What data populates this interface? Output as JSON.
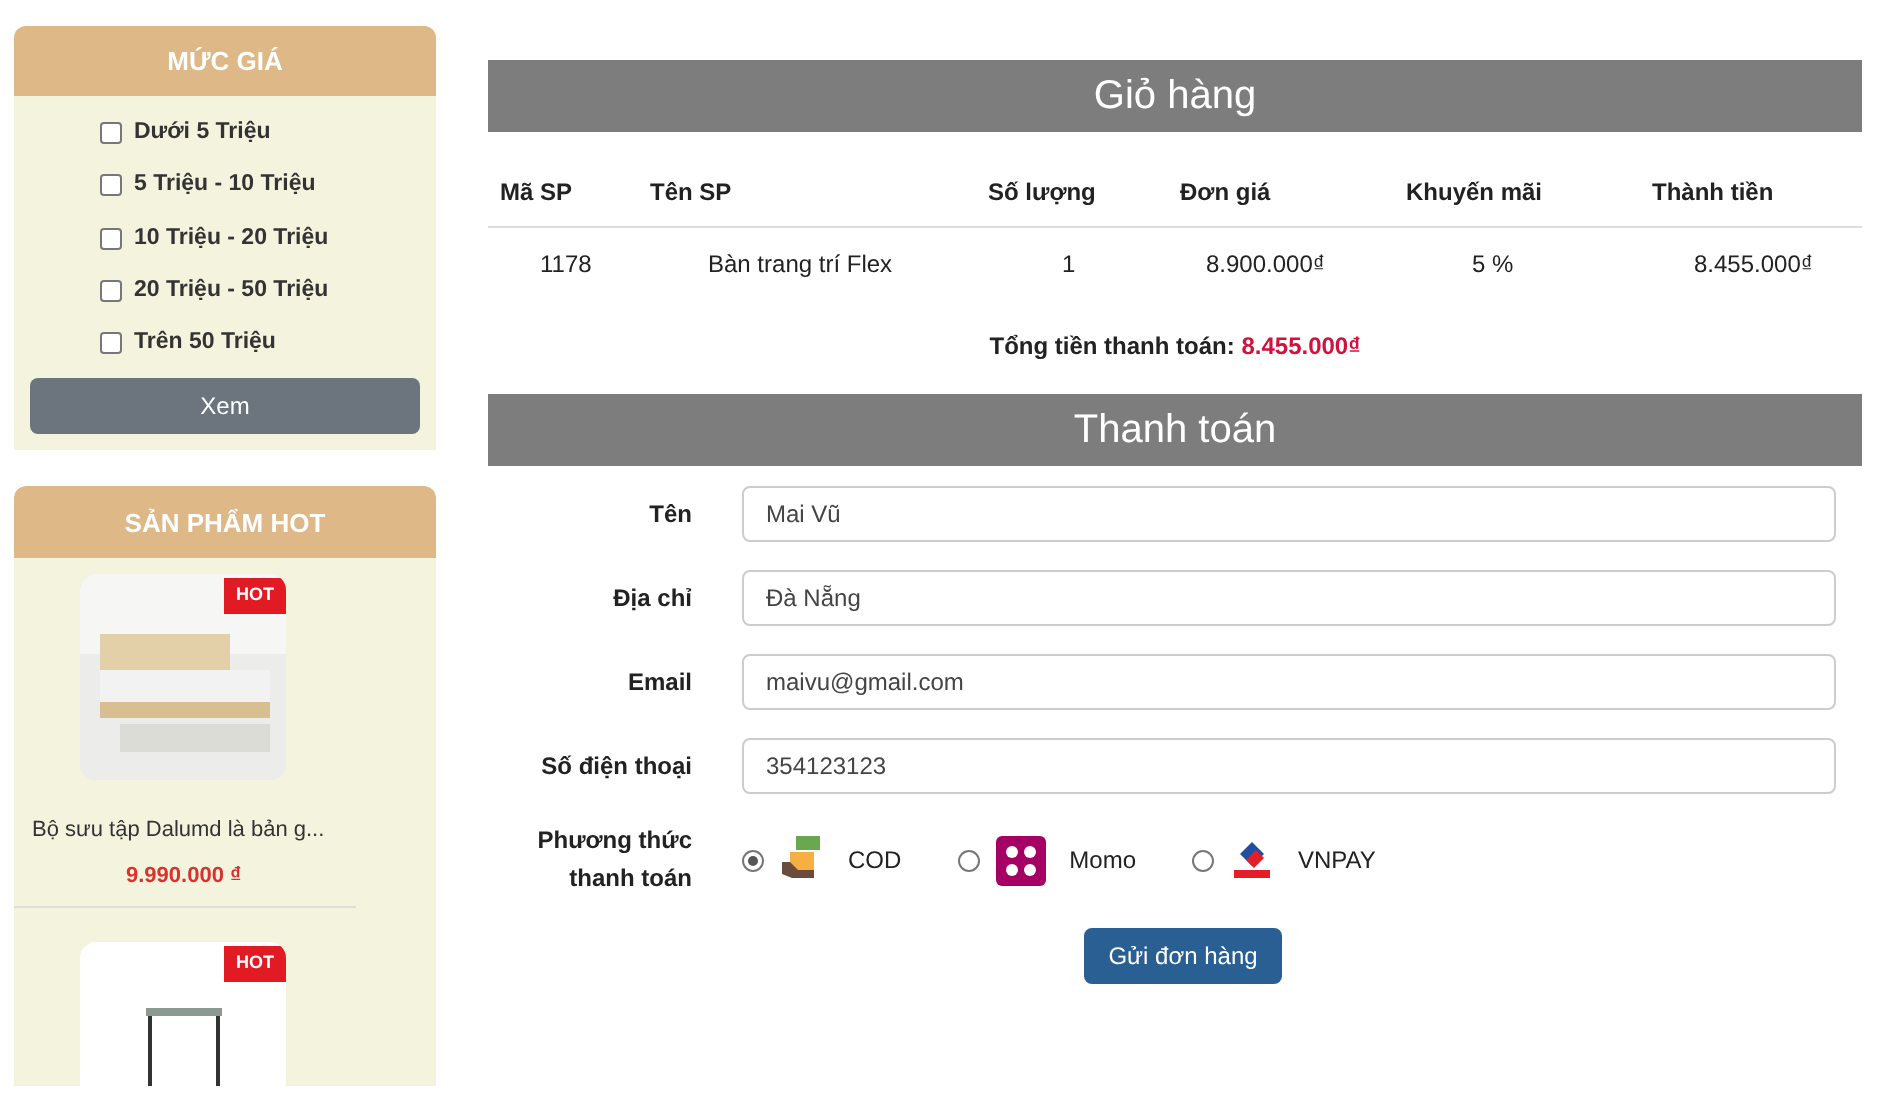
{
  "price_filter": {
    "title": "MỨC GIÁ",
    "options": [
      {
        "label": "Dưới 5 Triệu",
        "checked": false
      },
      {
        "label": "5 Triệu - 10 Triệu",
        "checked": false
      },
      {
        "label": "10 Triệu - 20 Triệu",
        "checked": false
      },
      {
        "label": "20 Triệu - 50 Triệu",
        "checked": false
      },
      {
        "label": "Trên 50 Triệu",
        "checked": false
      }
    ],
    "button": "Xem"
  },
  "hot_products": {
    "title": "SẢN PHẨM HOT",
    "items": [
      {
        "kind": "bed",
        "badge": "HOT",
        "name": "Bộ sưu tập Dalumd là bản g...",
        "price": "9.990.000 ₫"
      },
      {
        "kind": "table",
        "badge": "HOT"
      }
    ]
  },
  "cart": {
    "title": "Giỏ hàng",
    "columns": [
      "Mã SP",
      "Tên SP",
      "Số lượng",
      "Đơn giá",
      "Khuyến mãi",
      "Thành tiền"
    ],
    "rows": [
      [
        "1178",
        "Bàn trang trí Flex",
        "1",
        "8.900.000₫",
        "5 %",
        "8.455.000₫"
      ]
    ],
    "total_label": "Tổng tiền thanh toán:",
    "total_value": "8.455.000₫"
  },
  "checkout": {
    "title": "Thanh toán",
    "fields": [
      {
        "label": "Tên",
        "value": "Mai Vũ"
      },
      {
        "label": "Địa chỉ",
        "value": "Đà Nẵng"
      },
      {
        "label": "Email",
        "value": "maivu@gmail.com"
      },
      {
        "label": "Số điện thoại",
        "value": "354123123"
      }
    ],
    "payment_label": "Phương thức thanh toán",
    "payment_methods": [
      {
        "kind": "cod",
        "label": "COD",
        "selected": true
      },
      {
        "kind": "momo",
        "label": "Momo",
        "selected": false
      },
      {
        "kind": "vnpay",
        "label": "VNPAY",
        "selected": false
      }
    ],
    "submit": "Gửi đơn hàng"
  }
}
